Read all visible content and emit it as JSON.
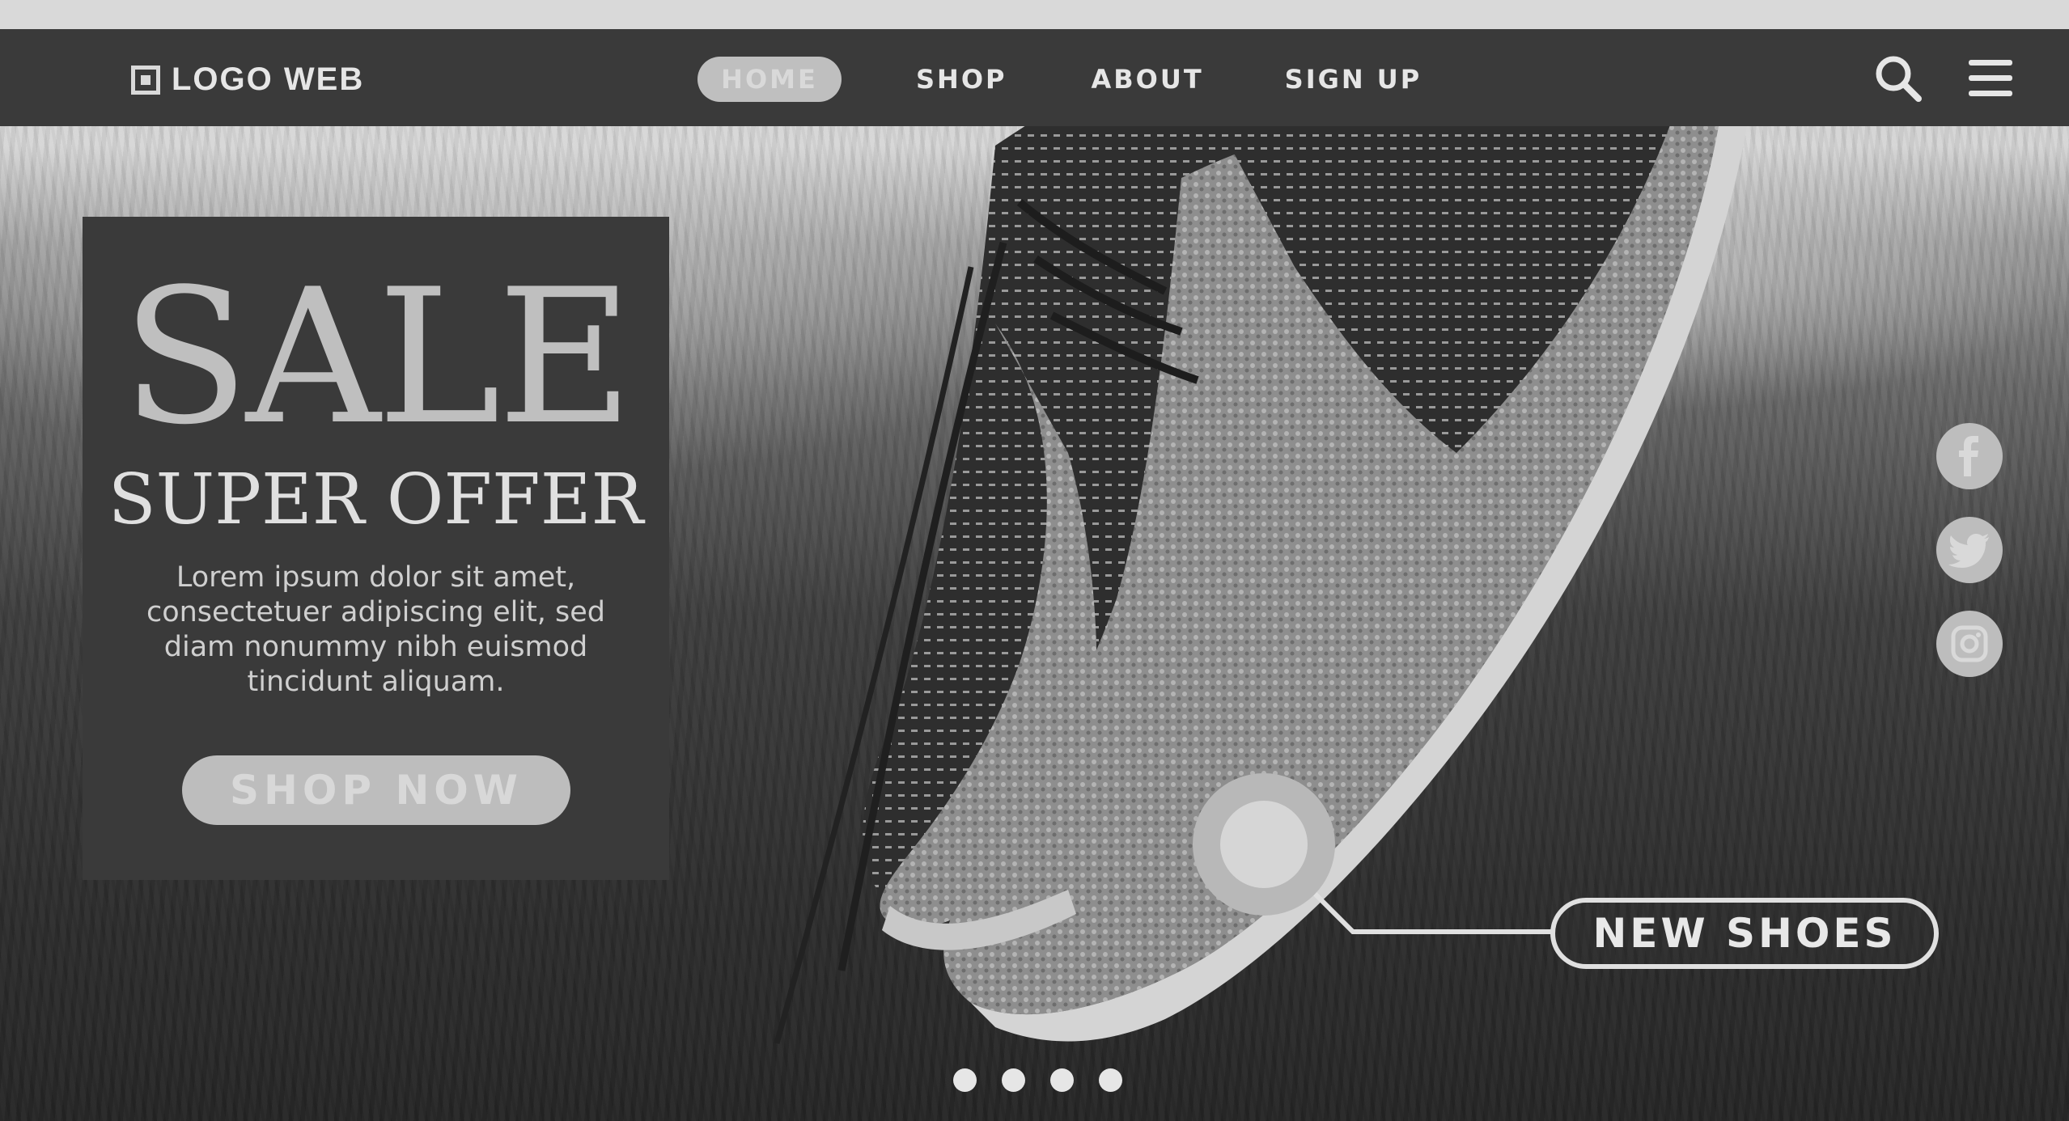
{
  "header": {
    "logo_icon": "square-logo-icon",
    "logo_text": "LOGO WEB",
    "nav": [
      {
        "label": "HOME",
        "active": true
      },
      {
        "label": "SHOP",
        "active": false
      },
      {
        "label": "ABOUT",
        "active": false
      },
      {
        "label": "SIGN UP",
        "active": false
      }
    ],
    "icons": [
      "search-icon",
      "menu-icon"
    ]
  },
  "hero": {
    "title": "SALE",
    "subtitle": "SUPER OFFER",
    "description": "Lorem ipsum dolor sit amet, consectetuer adipiscing elit, sed diam nonummy nibh euismod tincidunt aliquam.",
    "cta_label": "SHOP NOW"
  },
  "social": [
    "facebook-icon",
    "twitter-icon",
    "instagram-icon"
  ],
  "callout": {
    "label": "NEW SHOES"
  },
  "carousel": {
    "dot_count": 4
  },
  "colors": {
    "nav_bg": "#3a3a3a",
    "accent_light": "#bfbfbf",
    "text_light": "#e6e6e6"
  }
}
